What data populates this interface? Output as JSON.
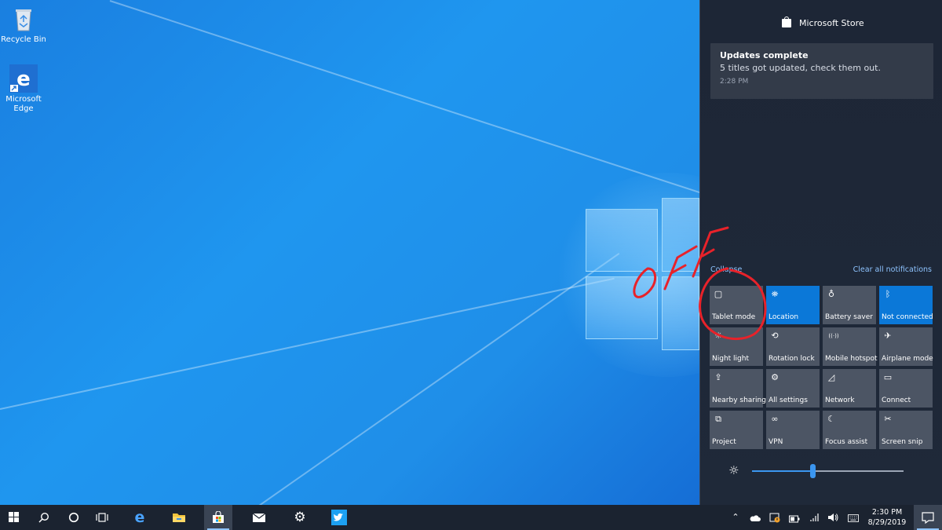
{
  "desktop": {
    "icons": [
      {
        "label": "Recycle Bin",
        "icon": "recycle-bin-icon"
      },
      {
        "label": "Microsoft Edge",
        "icon": "edge-icon"
      }
    ]
  },
  "action_center": {
    "app_header": {
      "name": "Microsoft Store",
      "icon": "store-icon"
    },
    "notification": {
      "title": "Updates complete",
      "body": "5 titles got updated, check them out.",
      "time": "2:28 PM"
    },
    "collapse_label": "Collapse",
    "clear_all_label": "Clear all notifications",
    "quick_actions": [
      {
        "label": "Tablet mode",
        "icon": "tablet-mode-icon",
        "on": false
      },
      {
        "label": "Location",
        "icon": "location-icon",
        "on": true
      },
      {
        "label": "Battery saver",
        "icon": "battery-saver-icon",
        "on": false
      },
      {
        "label": "Not connected",
        "icon": "bluetooth-icon",
        "on": true
      },
      {
        "label": "Night light",
        "icon": "night-light-icon",
        "on": false
      },
      {
        "label": "Rotation lock",
        "icon": "rotation-lock-icon",
        "on": false
      },
      {
        "label": "Mobile hotspot",
        "icon": "mobile-hotspot-icon",
        "on": false
      },
      {
        "label": "Airplane mode",
        "icon": "airplane-icon",
        "on": false
      },
      {
        "label": "Nearby sharing",
        "icon": "nearby-sharing-icon",
        "on": false
      },
      {
        "label": "All settings",
        "icon": "settings-icon",
        "on": false
      },
      {
        "label": "Network",
        "icon": "network-icon",
        "on": false
      },
      {
        "label": "Connect",
        "icon": "connect-icon",
        "on": false
      },
      {
        "label": "Project",
        "icon": "project-icon",
        "on": false
      },
      {
        "label": "VPN",
        "icon": "vpn-icon",
        "on": false
      },
      {
        "label": "Focus assist",
        "icon": "focus-assist-icon",
        "on": false
      },
      {
        "label": "Screen snip",
        "icon": "screen-snip-icon",
        "on": false
      }
    ],
    "brightness": {
      "level": 0.4
    }
  },
  "annotation": {
    "handwritten_text": "OFF",
    "color": "#e8222a"
  },
  "taskbar": {
    "buttons": [
      {
        "icon": "start-icon"
      },
      {
        "icon": "search-icon"
      },
      {
        "icon": "cortana-icon"
      },
      {
        "icon": "task-view-icon"
      },
      {
        "icon": "edge-icon"
      },
      {
        "icon": "file-explorer-icon"
      },
      {
        "icon": "store-icon",
        "active": true
      },
      {
        "icon": "mail-icon"
      },
      {
        "icon": "settings-icon"
      },
      {
        "icon": "twitter-icon"
      }
    ],
    "tray": [
      {
        "icon": "chevron-up-icon"
      },
      {
        "icon": "onedrive-icon"
      },
      {
        "icon": "defender-icon"
      },
      {
        "icon": "battery-icon"
      },
      {
        "icon": "wifi-icon"
      },
      {
        "icon": "volume-icon"
      },
      {
        "icon": "keyboard-icon"
      }
    ],
    "clock": {
      "time": "2:30 PM",
      "date": "8/29/2019"
    },
    "notification_button": {
      "icon": "action-center-icon"
    }
  },
  "colors": {
    "accent": "#0b78d8",
    "tile_off": "#4c5564",
    "panel": "#1f2939",
    "link": "#8ec4ff"
  }
}
